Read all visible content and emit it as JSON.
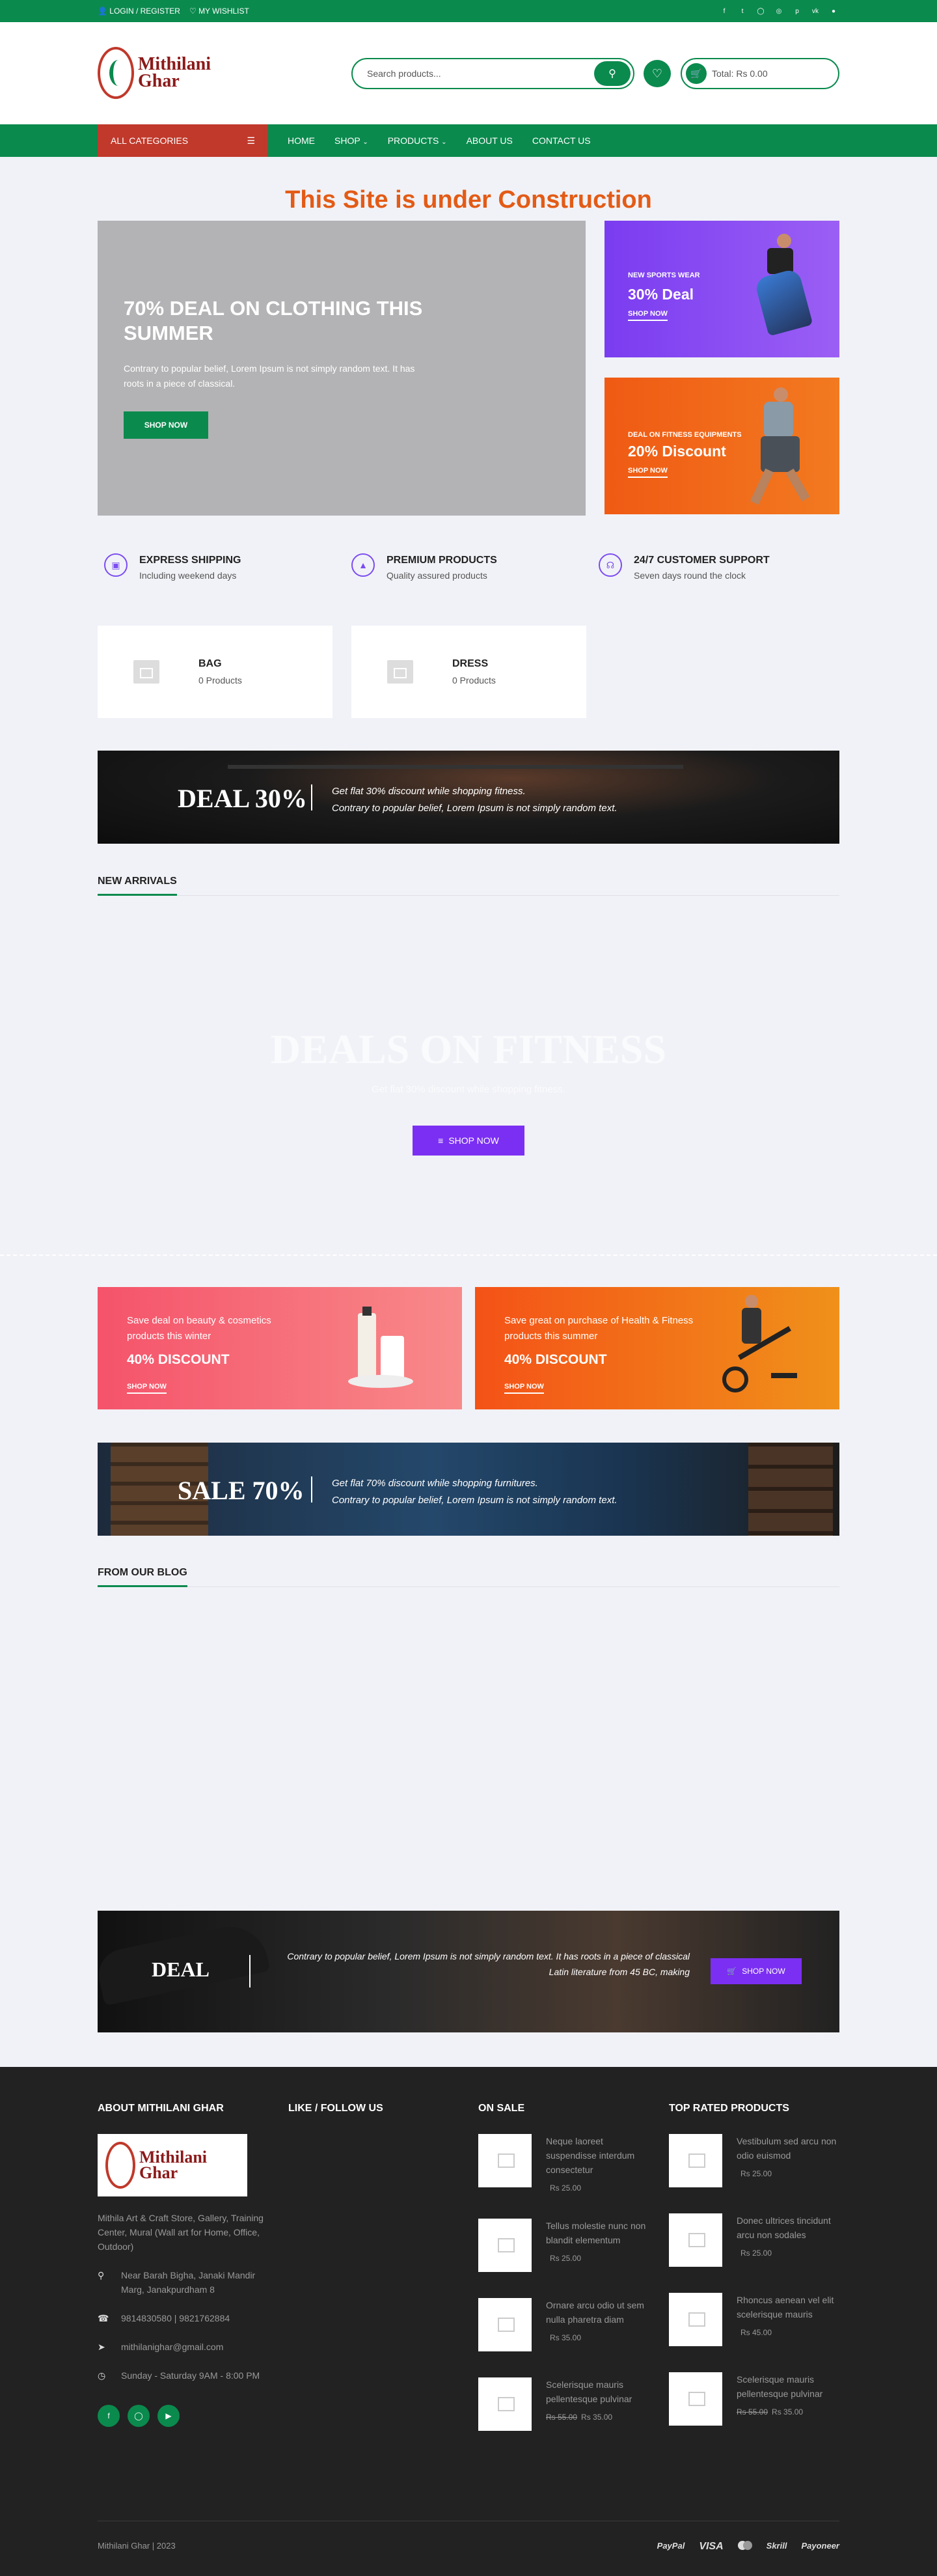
{
  "topbar": {
    "login": "LOGIN / REGISTER",
    "wishlist": "MY WISHLIST",
    "social": [
      "facebook-icon",
      "twitter-icon",
      "instagram-icon",
      "dribbble-icon",
      "pinterest-icon",
      "vk-icon",
      "spotify-icon"
    ]
  },
  "header": {
    "logo_text": "Mithilani Ghar",
    "search_placeholder": "Search products...",
    "cart_total": "Total: Rs 0.00"
  },
  "nav": {
    "all_categories": "ALL CATEGORIES",
    "items": [
      "HOME",
      "SHOP",
      "PRODUCTS",
      "ABOUT US",
      "CONTACT US"
    ]
  },
  "notice": "This Site is under Construction",
  "hero": {
    "title": "70% DEAL ON CLOTHING THIS SUMMER",
    "text": "Contrary to popular belief, Lorem Ipsum is not simply random text. It has roots in a piece of classical.",
    "button": "SHOP NOW"
  },
  "side_banners": [
    {
      "tag": "NEW SPORTS WEAR",
      "deal": "30% Deal",
      "link": "SHOP NOW"
    },
    {
      "tag": "DEAL ON FITNESS EQUIPMENTS",
      "deal": "20% Discount",
      "link": "SHOP NOW"
    }
  ],
  "features": [
    {
      "title": "EXPRESS SHIPPING",
      "desc": "Including weekend days",
      "icon": "truck-icon"
    },
    {
      "title": "PREMIUM PRODUCTS",
      "desc": "Quality assured products",
      "icon": "shirt-icon"
    },
    {
      "title": "24/7 CUSTOMER SUPPORT",
      "desc": "Seven days round the clock",
      "icon": "headset-icon"
    }
  ],
  "categories": [
    {
      "name": "BAG",
      "count": "0 Products"
    },
    {
      "name": "DRESS",
      "count": "0 Products"
    }
  ],
  "deal_banner_1": {
    "big": "DEAL 30%",
    "line1": "Get flat 30% discount while shopping fitness.",
    "line2": "Contrary to popular belief, Lorem Ipsum is not simply random text."
  },
  "new_arrivals": "NEW ARRIVALS",
  "fitness": {
    "title": "DEALS ON FITNESS",
    "subtitle": "Get flat 30% discount while shopping fitness.",
    "button": "SHOP NOW"
  },
  "promos": [
    {
      "text": "Save deal on beauty & cosmetics products this winter",
      "deal": "40% DISCOUNT",
      "link": "SHOP NOW"
    },
    {
      "text": "Save great on purchase of Health & Fitness products this summer",
      "deal": "40% DISCOUNT",
      "link": "SHOP NOW"
    }
  ],
  "sale_banner": {
    "big": "SALE 70%",
    "line1": "Get flat 70% discount while shopping furnitures.",
    "line2": "Contrary to popular belief, Lorem Ipsum is not simply random text."
  },
  "blog_title": "FROM OUR BLOG",
  "deal_banner_2": {
    "big": "DEAL",
    "text": "Contrary to popular belief, Lorem Ipsum is not simply random text. It has roots in a piece of classical Latin literature from 45 BC, making",
    "button": "SHOP NOW"
  },
  "footer": {
    "about_title": "ABOUT MITHILANI GHAR",
    "about_text": "Mithila Art & Craft Store, Gallery, Training Center, Mural (Wall art for Home, Office, Outdoor)",
    "address": "Near Barah Bigha, Janaki Mandir Marg, Janakpurdham 8",
    "phone": "9814830580 | 9821762884",
    "email": "mithilanighar@gmail.com",
    "hours": "Sunday - Saturday 9AM - 8:00 PM",
    "like_title": "LIKE / FOLLOW US",
    "sale_title": "ON SALE",
    "top_title": "TOP RATED PRODUCTS",
    "on_sale": [
      {
        "name": "Neque laoreet suspendisse interdum consectetur",
        "old": "",
        "price": "Rs 25.00"
      },
      {
        "name": "Tellus molestie nunc non blandit elementum",
        "old": "",
        "price": "Rs 25.00"
      },
      {
        "name": "Ornare arcu odio ut sem nulla pharetra diam",
        "old": "",
        "price": "Rs 35.00"
      },
      {
        "name": "Scelerisque mauris pellentesque pulvinar",
        "old": "Rs 55.00",
        "price": "Rs 35.00"
      }
    ],
    "top_rated": [
      {
        "name": "Vestibulum sed arcu non odio euismod",
        "old": "",
        "price": "Rs 25.00"
      },
      {
        "name": "Donec ultrices tincidunt arcu non sodales",
        "old": "",
        "price": "Rs 25.00"
      },
      {
        "name": "Rhoncus aenean vel elit scelerisque mauris",
        "old": "",
        "price": "Rs 45.00"
      },
      {
        "name": "Scelerisque mauris pellentesque pulvinar",
        "old": "Rs 55.00",
        "price": "Rs 35.00"
      }
    ],
    "copyright": "Mithilani Ghar | 2023",
    "payments": [
      "PayPal",
      "VISA",
      "mastercard",
      "Skrill",
      "Payoneer"
    ]
  }
}
